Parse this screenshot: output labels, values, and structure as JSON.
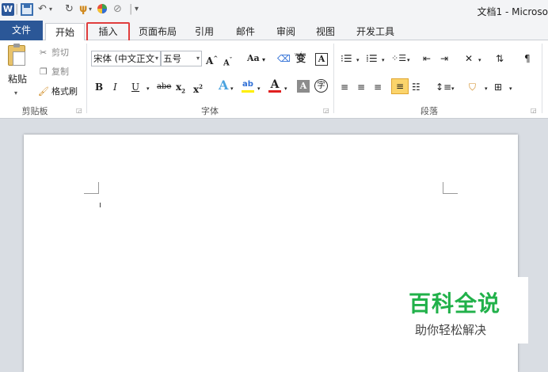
{
  "title_bar": {
    "app_badge": "W",
    "title": "文档1 - Microso",
    "qat": {
      "undo_glyph": "↶",
      "redo_glyph": "↻",
      "separator": "|",
      "customize_glyph": "▾"
    }
  },
  "tabs": [
    {
      "label": "文件"
    },
    {
      "label": "开始"
    },
    {
      "label": "插入"
    },
    {
      "label": "页面布局"
    },
    {
      "label": "引用"
    },
    {
      "label": "邮件"
    },
    {
      "label": "审阅"
    },
    {
      "label": "视图"
    },
    {
      "label": "开发工具"
    }
  ],
  "clipboard": {
    "paste_label": "粘贴",
    "cut_label": "剪切",
    "copy_label": "复制",
    "format_painter_label": "格式刷",
    "group_label": "剪贴板"
  },
  "font": {
    "font_name": "宋体 (中文正文",
    "font_size": "五号",
    "grow_glyph": "A",
    "shrink_glyph": "A",
    "case_glyph": "Aa",
    "bold": "B",
    "italic": "I",
    "underline": "U",
    "strike": "abe",
    "subscript": "x",
    "superscript": "x",
    "char_border": "A",
    "phonetic": "wén",
    "enclose": "字",
    "group_label": "字体"
  },
  "paragraph": {
    "group_label": "段落"
  },
  "colors": {
    "file_tab": "#2b5797",
    "insert_highlight": "#e03d3d",
    "watermark_green": "#21b14a"
  },
  "watermark": {
    "title": "百科全说",
    "subtitle": "助你轻松解决"
  }
}
